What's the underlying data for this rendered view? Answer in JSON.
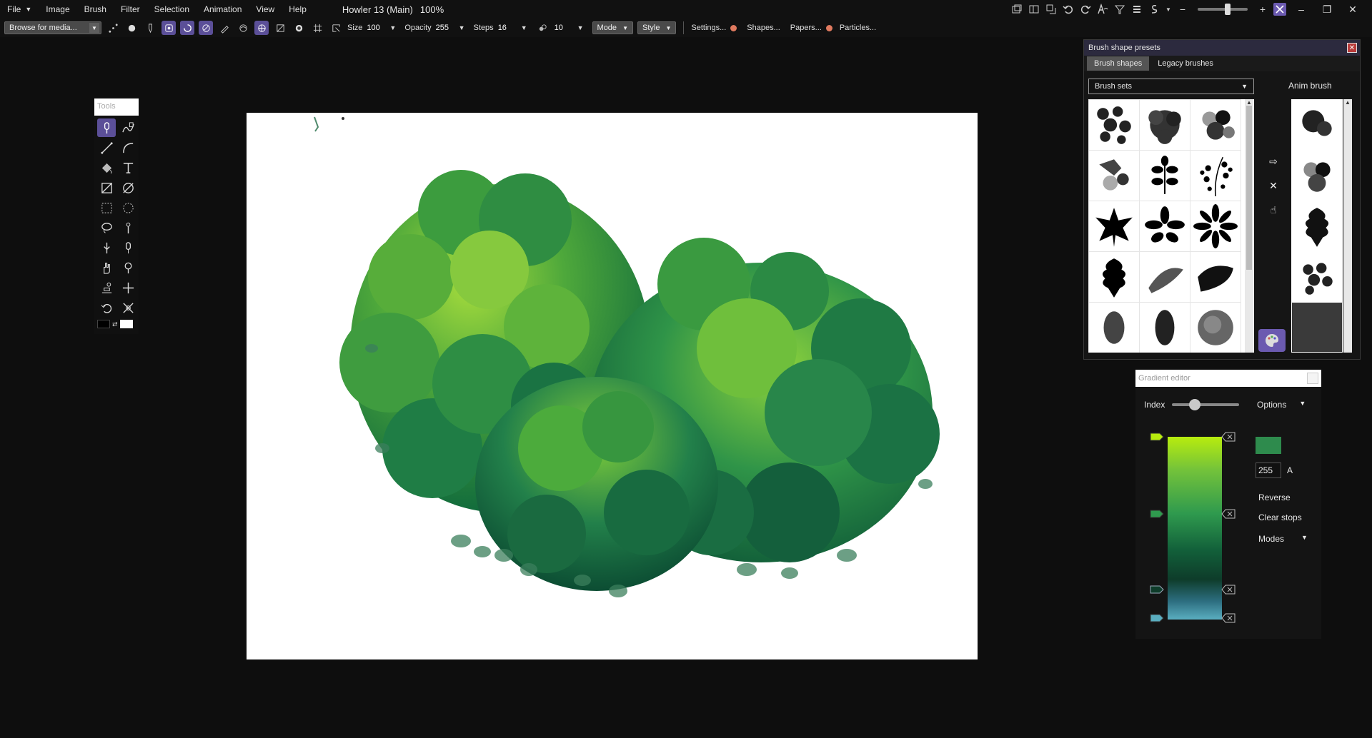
{
  "menubar": {
    "file": "File",
    "items": [
      "Image",
      "Brush",
      "Filter",
      "Selection",
      "Animation",
      "View",
      "Help"
    ],
    "title": "Howler 13 (Main)",
    "zoom": "100%"
  },
  "toolbar": {
    "media_combo": "Browse for media...",
    "size_label": "Size",
    "size_value": "100",
    "opacity_label": "Opacity",
    "opacity_value": "255",
    "steps_label": "Steps",
    "steps_value": "16",
    "stamp_value": "10",
    "mode_label": "Mode",
    "style_label": "Style",
    "settings_label": "Settings...",
    "shapes_label": "Shapes...",
    "papers_label": "Papers...",
    "particles_label": "Particles..."
  },
  "tools": {
    "title": "Tools"
  },
  "brush_panel": {
    "title": "Brush shape presets",
    "tab_shapes": "Brush shapes",
    "tab_legacy": "Legacy brushes",
    "brush_sets": "Brush sets",
    "anim_label": "Anim brush",
    "shapes": [
      "leaf-cluster",
      "leaf-cluster-dark",
      "leaf-cluster-grey",
      "leaf-mix",
      "leaf-branch",
      "fern-sprig",
      "maple-leaf",
      "palm-leaves",
      "daisy-petals",
      "oak-leaf",
      "dry-brush-stroke",
      "dry-brush-stroke-2",
      "grunge-spot",
      "grunge-spot-2",
      "grey-blob"
    ]
  },
  "gradient_editor": {
    "title": "Gradient editor",
    "index_label": "Index",
    "options_label": "Options",
    "alpha_value": "255",
    "alpha_label": "A",
    "reverse_label": "Reverse",
    "clear_stops_label": "Clear stops",
    "modes_label": "Modes",
    "current_color": "#2e8b4d",
    "stops": [
      "#b8ec0e",
      "#2f9a4e",
      "#0e3c2a",
      "#5aaec0"
    ]
  }
}
